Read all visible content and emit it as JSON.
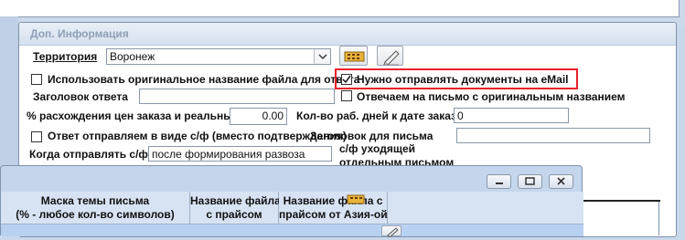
{
  "panel": {
    "title": "Доп. Информация",
    "territory_label": "Территория",
    "territory_value": "Воронеж",
    "use_original_filename_label": "Использовать оригинальное название файла для ответа",
    "send_email_label": "Нужно отправлять документы на eMail",
    "reply_header_label": "Заголовок ответа",
    "reply_header_value": "",
    "reply_original_label": "Отвечаем на письмо с оригинальным названием",
    "price_diff_label": "% расхождения цен заказа и реальных",
    "price_diff_value": "0.00",
    "workdays_label": "Кол-во раб. дней к дате заказа",
    "workdays_value": "0",
    "reply_as_invoice_label": "Ответ отправляем в виде с/ф (вместо подтверждения)",
    "letter_header_label": "Заголовок для письма",
    "letter_header_suffix": "с/ф уходящей",
    "separate_letter_label": "отдельным письмом",
    "letter_header_value": "",
    "when_send_label": "Когда отправлять с/ф",
    "when_send_value": "после формирования развоза"
  },
  "grid": {
    "columns": [
      "Маска темы письма\n(% - любое кол-во символов)",
      "Название файла\nс прайсом",
      "Название файла с\nпрайсом от Азия-ойл"
    ]
  },
  "colors": {
    "highlight": "#e8202a",
    "panel_bg": "#ffffff",
    "window_bg": "#c5d6ec"
  }
}
